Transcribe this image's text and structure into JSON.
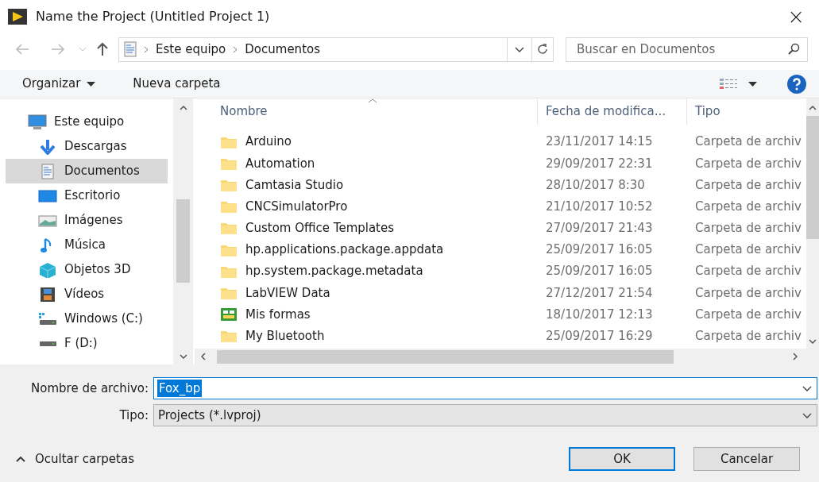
{
  "window": {
    "title": "Name the Project (Untitled Project 1)",
    "close": "×"
  },
  "address_bar": {
    "path": [
      "Este equipo",
      "Documentos"
    ]
  },
  "search": {
    "placeholder": "Buscar en Documentos"
  },
  "toolbar": {
    "organize": "Organizar",
    "new_folder": "Nueva carpeta"
  },
  "sidebar": {
    "items": [
      {
        "label": "Este equipo",
        "kind": "pc",
        "selected": false
      },
      {
        "label": "Descargas",
        "kind": "download",
        "selected": false
      },
      {
        "label": "Documentos",
        "kind": "docs",
        "selected": true
      },
      {
        "label": "Escritorio",
        "kind": "desktop",
        "selected": false
      },
      {
        "label": "Imágenes",
        "kind": "images",
        "selected": false
      },
      {
        "label": "Música",
        "kind": "music",
        "selected": false
      },
      {
        "label": "Objetos 3D",
        "kind": "cube",
        "selected": false
      },
      {
        "label": "Vídeos",
        "kind": "video",
        "selected": false
      },
      {
        "label": "Windows (C:)",
        "kind": "windrive",
        "selected": false
      },
      {
        "label": "F (D:)",
        "kind": "drive",
        "selected": false
      }
    ]
  },
  "table": {
    "columns": [
      "Nombre",
      "Fecha de modifica...",
      "Tipo"
    ],
    "rows": [
      {
        "name": "Arduino",
        "date": "23/11/2017 14:15",
        "type": "Carpeta de archiv",
        "kind": "folder"
      },
      {
        "name": "Automation",
        "date": "29/09/2017 22:31",
        "type": "Carpeta de archiv",
        "kind": "folder"
      },
      {
        "name": "Camtasia Studio",
        "date": "28/10/2017 8:30",
        "type": "Carpeta de archiv",
        "kind": "folder"
      },
      {
        "name": "CNCSimulatorPro",
        "date": "21/10/2017 10:52",
        "type": "Carpeta de archiv",
        "kind": "folder"
      },
      {
        "name": "Custom Office Templates",
        "date": "27/09/2017 21:43",
        "type": "Carpeta de archiv",
        "kind": "folder"
      },
      {
        "name": "hp.applications.package.appdata",
        "date": "25/09/2017 16:05",
        "type": "Carpeta de archiv",
        "kind": "folder"
      },
      {
        "name": "hp.system.package.metadata",
        "date": "25/09/2017 16:05",
        "type": "Carpeta de archiv",
        "kind": "folder"
      },
      {
        "name": "LabVIEW Data",
        "date": "27/12/2017 21:54",
        "type": "Carpeta de archiv",
        "kind": "folder"
      },
      {
        "name": "Mis formas",
        "date": "18/10/2017 12:13",
        "type": "Carpeta de archiv",
        "kind": "forms"
      },
      {
        "name": "My Bluetooth",
        "date": "25/09/2017 16:29",
        "type": "Carpeta de archiv",
        "kind": "folder"
      }
    ]
  },
  "file_name": {
    "label": "Nombre de archivo:",
    "value": "Fox_bp"
  },
  "file_type": {
    "label": "Tipo:",
    "value": "Projects (*.lvproj)"
  },
  "footer": {
    "hide_folders": "Ocultar carpetas",
    "ok": "OK",
    "cancel": "Cancelar"
  }
}
